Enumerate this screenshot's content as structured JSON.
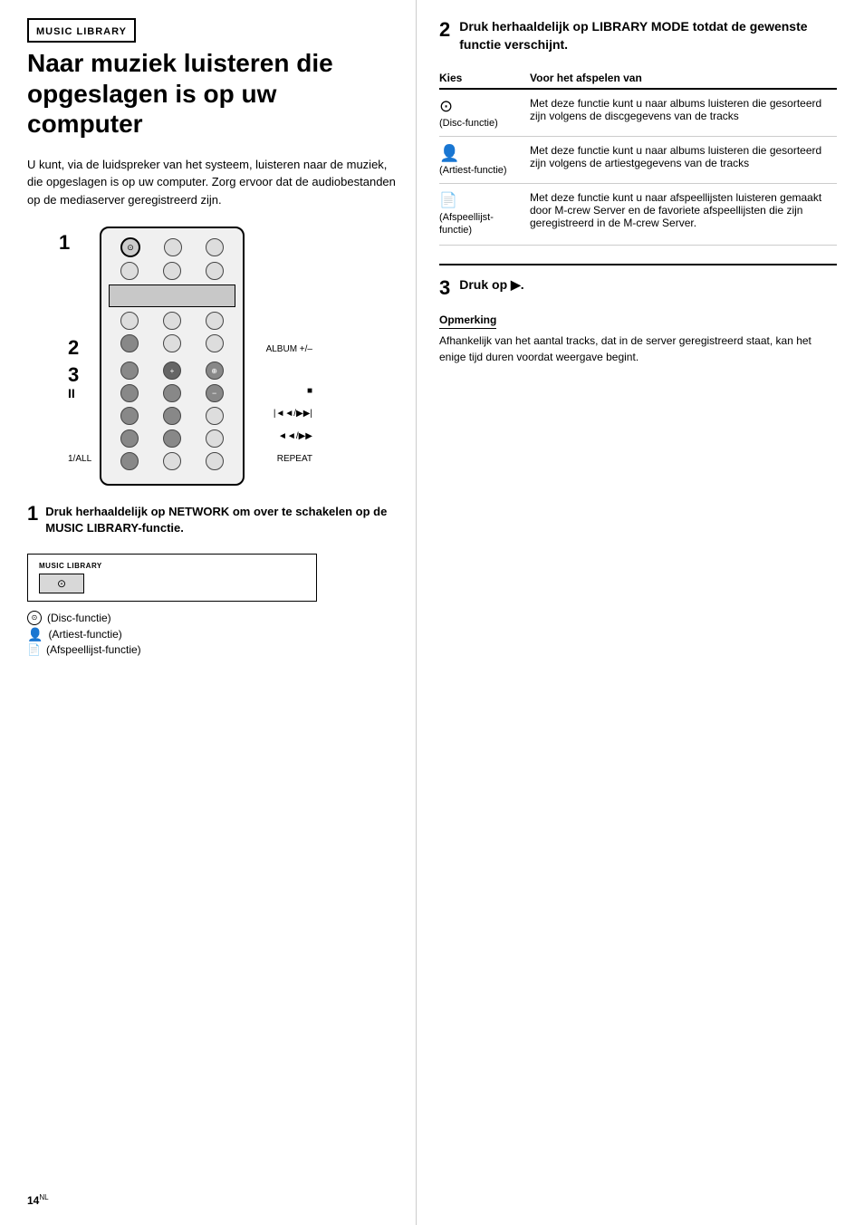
{
  "left": {
    "section_label": "MUSIC LIBRARY",
    "title": "Naar muziek luisteren die opgeslagen is op uw computer",
    "intro": "U kunt, via de luidspreker van het systeem, luisteren naar de muziek, die opgeslagen is op uw computer. Zorg ervoor dat de audiobestanden op de mediaserver geregistreerd zijn.",
    "step1": {
      "number": "1",
      "text": "Druk herhaaldelijk op NETWORK om over te schakelen op de MUSIC LIBRARY-functie."
    },
    "display_label": "MUSIC  LIBRARY",
    "icons": [
      {
        "id": "disc",
        "label": "(Disc-functie)"
      },
      {
        "id": "person",
        "label": "(Artiest-functie)"
      },
      {
        "id": "file",
        "label": "(Afspeellijst-functie)"
      }
    ],
    "remote_labels": {
      "album": "ALBUM +/–",
      "stop": "■",
      "skip_ff": "◄◄/▶▶|",
      "skip": "◄◄/▶▶",
      "repeat": "REPEAT",
      "one_all": "1/ALL",
      "step_numbers": [
        "1",
        "2",
        "3",
        "pause"
      ]
    }
  },
  "right": {
    "step2": {
      "number": "2",
      "text": "Druk herhaaldelijk op LIBRARY MODE totdat de gewenste functie verschijnt."
    },
    "table": {
      "col1": "Kies",
      "col2": "Voor het afspelen van",
      "rows": [
        {
          "icon": "disc",
          "icon_label": "(Disc-functie)",
          "description": "Met deze functie kunt u naar albums luisteren die gesorteerd zijn volgens de discgegevens van de tracks"
        },
        {
          "icon": "person",
          "icon_label": "(Artiest-functie)",
          "description": "Met deze functie kunt u naar albums luisteren die gesorteerd zijn volgens de artiestgegevens van de tracks"
        },
        {
          "icon": "file",
          "icon_label": "(Afspeellijst-functie)",
          "description": "Met deze functie kunt u naar afspeellijsten luisteren gemaakt door M-crew Server en de favoriete afspeellijsten die zijn geregistreerd in de M-crew Server."
        }
      ]
    },
    "step3": {
      "number": "3",
      "text": "Druk op ▶."
    },
    "opmerking": {
      "title": "Opmerking",
      "text": "Afhankelijk van het aantal tracks, dat in de server geregistreerd staat, kan het enige tijd duren voordat weergave begint."
    }
  },
  "page_number": "14",
  "page_number_sup": "NL"
}
